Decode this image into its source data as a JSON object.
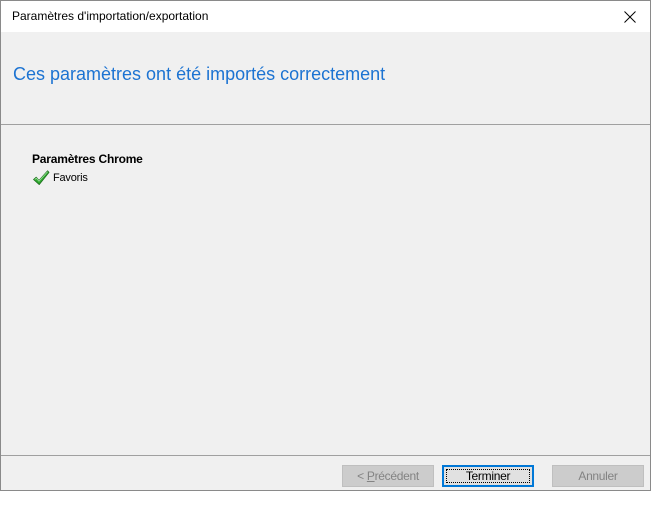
{
  "window": {
    "title": "Paramètres d'importation/exportation"
  },
  "header": {
    "title": "Ces paramètres ont été importés correctement"
  },
  "content": {
    "section_heading": "Paramètres Chrome",
    "items": [
      {
        "label": "Favoris",
        "status_icon": "checkmark-icon",
        "status_color": "#2fa82f"
      }
    ]
  },
  "footer": {
    "prev_button": {
      "prefix": "< ",
      "mnemonic": "P",
      "rest": "récédent",
      "enabled": false
    },
    "finish_button": {
      "label": "Terminer",
      "enabled": true,
      "default": true
    },
    "cancel_button": {
      "label": "Annuler",
      "enabled": false
    }
  },
  "colors": {
    "header_title": "#1c73d2",
    "panel_background": "#f0f0f0",
    "default_button_border": "#0078d7"
  }
}
